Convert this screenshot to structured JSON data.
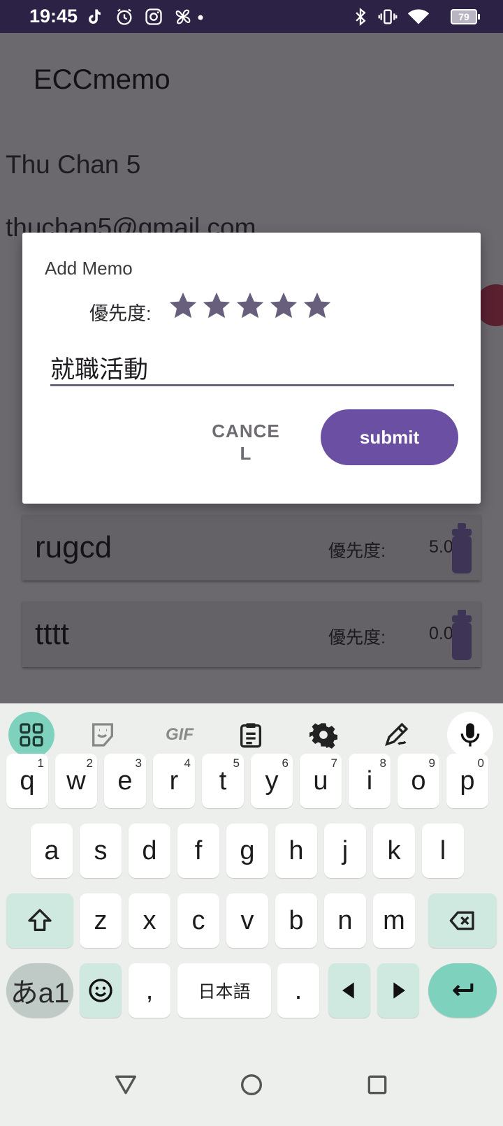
{
  "status_bar": {
    "time": "19:45",
    "battery": "79",
    "icons": [
      "tiktok-icon",
      "alarm-icon",
      "instagram-icon",
      "pinwheel-icon",
      "dot-icon",
      "bluetooth-icon",
      "vibrate-icon",
      "wifi-icon",
      "battery-icon"
    ]
  },
  "app": {
    "title": "ECCmemo",
    "user_name": "Thu Chan 5",
    "user_email": "thuchan5@gmail.com",
    "memos": [
      {
        "title": "rugcd",
        "priority_label": "優先度:",
        "priority_value": "5.0"
      },
      {
        "title": "tttt",
        "priority_label": "優先度:",
        "priority_value": "0.0"
      }
    ]
  },
  "dialog": {
    "title": "Add Memo",
    "priority_label": "優先度:",
    "stars": 5,
    "input_value": "就職活動",
    "cancel_label": "CANCE\nL",
    "submit_label": "submit"
  },
  "keyboard": {
    "toolbar": [
      "apps-icon",
      "sticker-icon",
      "gif-icon",
      "clipboard-icon",
      "settings-icon",
      "handwriting-icon",
      "mic-icon"
    ],
    "gif_label": "GIF",
    "row1": [
      {
        "key": "q",
        "hint": "1"
      },
      {
        "key": "w",
        "hint": "2"
      },
      {
        "key": "e",
        "hint": "3"
      },
      {
        "key": "r",
        "hint": "4"
      },
      {
        "key": "t",
        "hint": "5"
      },
      {
        "key": "y",
        "hint": "6"
      },
      {
        "key": "u",
        "hint": "7"
      },
      {
        "key": "i",
        "hint": "8"
      },
      {
        "key": "o",
        "hint": "9"
      },
      {
        "key": "p",
        "hint": "0"
      }
    ],
    "row2": [
      "a",
      "s",
      "d",
      "f",
      "g",
      "h",
      "j",
      "k",
      "l"
    ],
    "row3": [
      "z",
      "x",
      "c",
      "v",
      "b",
      "n",
      "m"
    ],
    "lang_key": "あa1",
    "comma": ",",
    "space_label": "日本語",
    "period": "."
  },
  "colors": {
    "accent": "#6a4fa3",
    "keyboard_accent": "#7ed2bd",
    "status_bar": "#2b2245"
  }
}
